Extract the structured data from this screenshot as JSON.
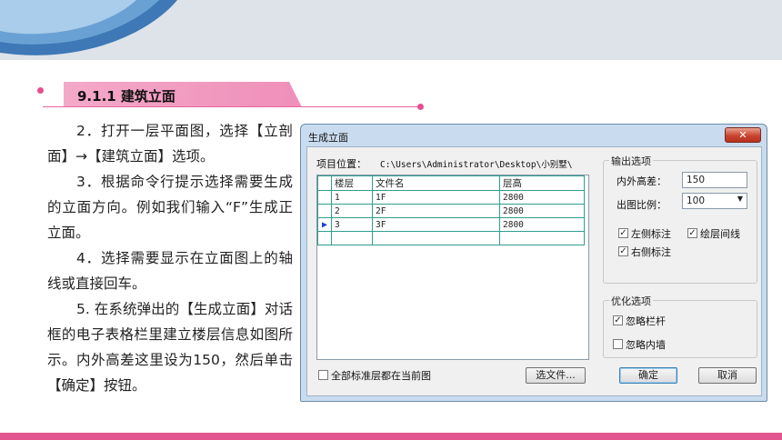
{
  "section": {
    "title": "9.1.1 建筑立面"
  },
  "body": {
    "paragraphs": [
      "2．打开一层平面图，选择【立剖面】→【建筑立面】选项。",
      "3．根据命令行提示选择需要生成的立面方向。例如我们输入“F”生成正立面。",
      "4．选择需要显示在立面图上的轴线或直接回车。",
      "5. 在系统弹出的【生成立面】对话框的电子表格栏里建立楼层信息如图所示。内外高差这里设为150，然后单击【确定】按钮。"
    ]
  },
  "dialog": {
    "title": "生成立面",
    "close_label": "✕",
    "project_label": "项目位置：",
    "project_path": "C:\\Users\\Administrator\\Desktop\\小别墅\\",
    "table": {
      "headers": [
        "楼层",
        "文件名",
        "层高"
      ],
      "rows": [
        {
          "floor": "1",
          "file": "1F",
          "height": "2800"
        },
        {
          "floor": "2",
          "file": "2F",
          "height": "2800"
        },
        {
          "floor": "3",
          "file": "3F",
          "height": "2800"
        }
      ],
      "current_row_marker": "▶"
    },
    "output_group": {
      "title": "输出选项",
      "height_diff_label": "内外高差：",
      "height_diff_value": "150",
      "scale_label": "出图比例：",
      "scale_value": "100",
      "left_label": "左侧标注",
      "floor_line_label": "绘层间线",
      "right_label": "右侧标注"
    },
    "optimize_group": {
      "title": "优化选项",
      "ignore_railing_label": "忽略栏杆",
      "ignore_inner_wall_label": "忽略内墙"
    },
    "all_floors_label": "全部标准层都在当前图",
    "select_file_button": "选文件...",
    "ok_button": "确定",
    "cancel_button": "取消",
    "check_mark": "✓"
  }
}
